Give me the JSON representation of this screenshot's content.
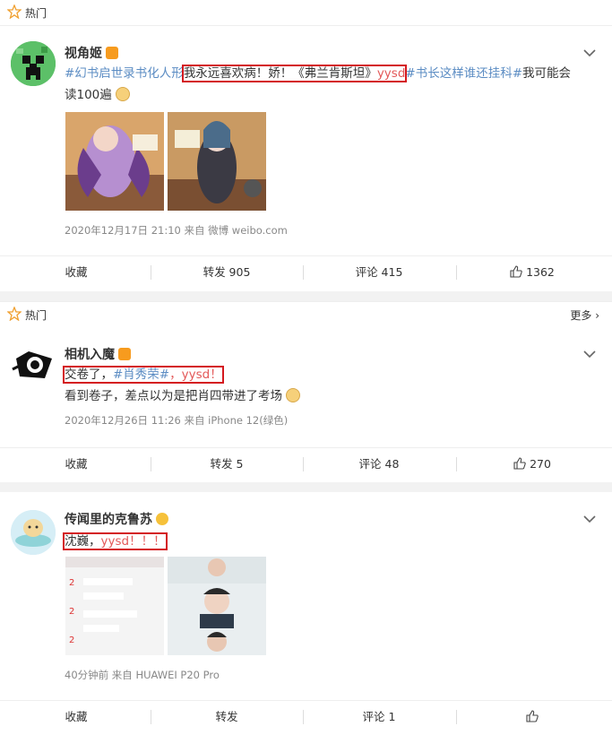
{
  "section1": {
    "hot_label": "热门"
  },
  "post1": {
    "username": "视角姬",
    "text_tag1": "#幻书启世录书化人形",
    "text_hl": "我永远喜欢病！娇！《弗兰肯斯坦》",
    "text_red": "yysd",
    "text_tag2": "#书长这样谁还挂科#",
    "text_rest1": "我可能会",
    "text_line2": "读100遍",
    "meta": "2020年12月17日 21:10  来自 微博 weibo.com",
    "actions": {
      "favorite": "收藏",
      "repost": "转发 905",
      "comment": "评论 415",
      "like": "1362"
    }
  },
  "section2": {
    "hot_label": "热门",
    "more_label": "更多 ›"
  },
  "post2": {
    "username": "相机入魔",
    "line1_a": "交卷了，",
    "line1_tag": "#肖秀荣#",
    "line1_b": "，",
    "line1_red": "yysd",
    "line1_c": "！",
    "line2": "看到卷子，差点以为是把肖四带进了考场",
    "meta": "2020年12月26日 11:26  来自 iPhone 12(绿色)",
    "actions": {
      "favorite": "收藏",
      "repost": "转发 5",
      "comment": "评论 48",
      "like": "270"
    }
  },
  "post3": {
    "username": "传闻里的克鲁苏",
    "line1_a": "沈巍，",
    "line1_red": "yysd",
    "line1_b": "！！！",
    "meta": "40分钟前  来自 HUAWEI P20 Pro",
    "actions": {
      "favorite": "收藏",
      "repost": "转发",
      "comment": "评论 1"
    }
  },
  "colors": {
    "tag_blue": "#5b8cc3",
    "highlight_red": "#d4191f",
    "yysd_red": "#e35959",
    "verified_orange": "#f79b1e"
  }
}
